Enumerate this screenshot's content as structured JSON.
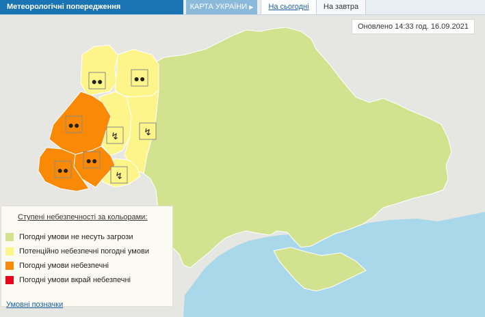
{
  "header": {
    "title": "Метеорологічні попередження",
    "tabs": [
      {
        "label": "КАРТА УКРАЇНИ",
        "active": true
      },
      {
        "label": "На сьогодні",
        "active": false
      },
      {
        "label": "На завтра",
        "active": false
      }
    ]
  },
  "updated": "Оновлено 14:33 год. 16.09.2021",
  "legend": {
    "title": "Ступені небезпечності за кольорами:",
    "items": [
      {
        "label": "Погодні умови не несуть загрози",
        "color": "#d3e28e"
      },
      {
        "label": "Потенційно небезпечні погодні умови",
        "color": "#fdf58a"
      },
      {
        "label": "Погодні умови небезпечні",
        "color": "#fa8a06"
      },
      {
        "label": "Погодні умови вкрай небезпечні",
        "color": "#e8061d"
      }
    ]
  },
  "symbols_link": "Умовні позначки",
  "colors": {
    "header_blue": "#1a74b4",
    "sea": "#a9d8ea",
    "land_neutral": "#e6e6e2",
    "green": "#d3e28e",
    "yellow": "#fdf58a",
    "orange": "#fa8a06",
    "region_border": "#ffffff"
  },
  "warnings": [
    {
      "region": "Волинська",
      "level": "yellow",
      "icon": "rain-icon"
    },
    {
      "region": "Рівненська",
      "level": "yellow",
      "icon": "rain-icon"
    },
    {
      "region": "Львівська",
      "level": "orange",
      "icon": "rain-icon"
    },
    {
      "region": "Тернопільська",
      "level": "yellow",
      "icon": "thunderstorm-icon"
    },
    {
      "region": "Хмельницька",
      "level": "yellow",
      "icon": "thunderstorm-icon"
    },
    {
      "region": "Закарпатська",
      "level": "orange",
      "icon": "rain-icon"
    },
    {
      "region": "Івано-Франківська",
      "level": "orange",
      "icon": "rain-icon"
    },
    {
      "region": "Чернівецька",
      "level": "yellow",
      "icon": "thunderstorm-icon"
    }
  ]
}
